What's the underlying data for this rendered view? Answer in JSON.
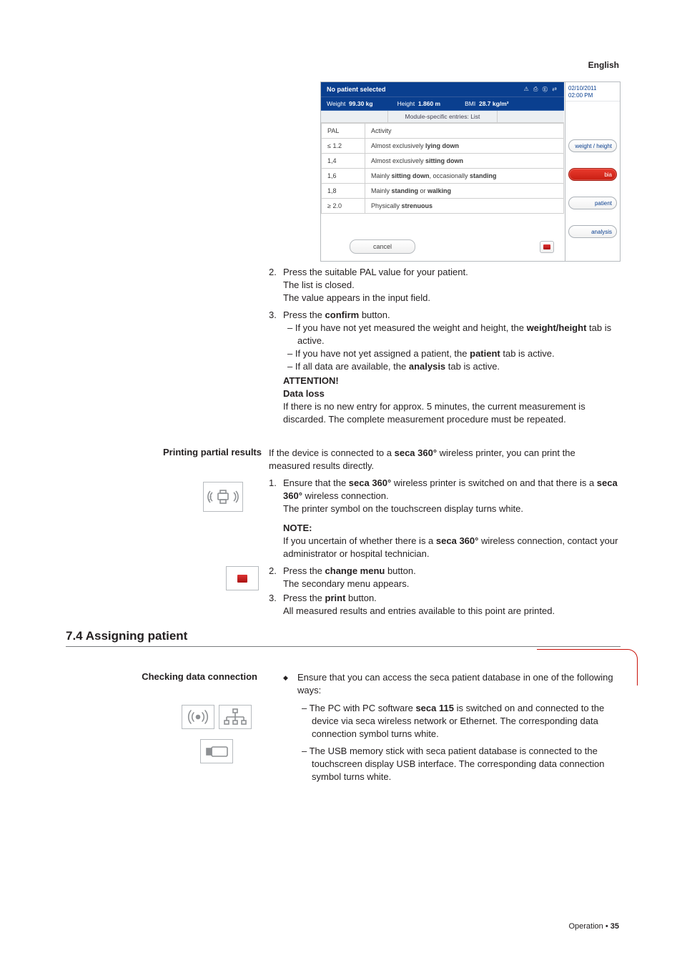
{
  "lang": "English",
  "screenshot": {
    "title": "No patient selected",
    "statusIcons": "⚠  ⎙  Ⓔ  ⇄",
    "sub": {
      "weightLabel": "Weight",
      "weightValue": "99.30 kg",
      "heightLabel": "Height",
      "heightValue": "1.860 m",
      "bmiLabel": "BMI",
      "bmiValue": "28.7 kg/m²"
    },
    "sub2": "Module-specific entries: List",
    "rows": [
      {
        "a": "PAL",
        "b": "Activity"
      },
      {
        "a": "≤ 1.2",
        "b": "Almost exclusively <b>lying down</b>"
      },
      {
        "a": "1,4",
        "b": "Almost exclusively <b>sitting down</b>"
      },
      {
        "a": "1,6",
        "b": "Mainly <b>sitting down</b>, occasionally <b>standing</b>"
      },
      {
        "a": "1,8",
        "b": "Mainly <b>standing</b> or <b>walking</b>"
      },
      {
        "a": "≥ 2.0",
        "b": "Physically <b>strenuous</b>"
      }
    ],
    "cancel": "cancel",
    "side": {
      "date": "02/10/2011",
      "time": "02:00 PM",
      "tabs": [
        "weight / height",
        "bia",
        "patient",
        "analysis"
      ]
    }
  },
  "step2": {
    "num": "2.",
    "lines": [
      "Press the suitable PAL value for your patient.",
      "The list is closed.",
      "The value appears in the input field."
    ]
  },
  "step3": {
    "num": "3.",
    "line1_a": "Press the ",
    "line1_b": "confirm",
    "line1_c": " button.",
    "d1_a": "If you have not yet measured the weight and height, the ",
    "d1_b": "weight/height",
    "d1_c": " tab is active.",
    "d2_a": "If you have not yet assigned a patient, the ",
    "d2_b": "patient",
    "d2_c": " tab is active.",
    "d3_a": "If all data are available, the ",
    "d3_b": "analysis",
    "d3_c": " tab is active."
  },
  "attention": {
    "title": "ATTENTION!",
    "subtitle": "Data loss",
    "body": "If there is no new entry for approx. 5 minutes, the current measurement is discarded. The complete measurement procedure must be repeated."
  },
  "sectionPrinting": {
    "heading": "Printing partial results",
    "intro_a": "If the device is connected to a ",
    "intro_b": "seca 360°",
    "intro_c": " wireless printer, you can print the measured results directly.",
    "s1": {
      "num": "1.",
      "l1_a": "Ensure that the ",
      "l1_b": "seca 360°",
      "l1_c": " wireless printer is switched on and that there is a ",
      "l1_d": "seca 360°",
      "l1_e": " wireless connection.",
      "l2": "The printer symbol on the touchscreen display turns white."
    },
    "note": {
      "title": "NOTE:",
      "body_a": "If you uncertain of whether there is a ",
      "body_b": "seca 360°",
      "body_c": " wireless connection, contact your administrator or hospital technician."
    },
    "s2": {
      "num": "2.",
      "l1_a": "Press the ",
      "l1_b": "change menu",
      "l1_c": " button.",
      "l2": "The secondary menu appears."
    },
    "s3": {
      "num": "3.",
      "l1_a": "Press the ",
      "l1_b": "print",
      "l1_c": " button.",
      "l2": "All measured results and entries available to this point are printed."
    }
  },
  "sectionAssign": {
    "heading": "7.4   Assigning patient",
    "subheading": "Checking data connection",
    "bullet": "Ensure that you can access the seca patient database in one of the following ways:",
    "d1_a": "The PC with PC software ",
    "d1_b": "seca 115",
    "d1_c": " is switched on and connected to the device via seca wireless network or Ethernet. The corresponding data connection symbol turns white.",
    "d2": "The USB memory stick with seca patient database is connected to the touchscreen display USB interface. The corresponding data connection symbol turns white."
  },
  "footer": {
    "left": "Operation • ",
    "page": "35"
  }
}
